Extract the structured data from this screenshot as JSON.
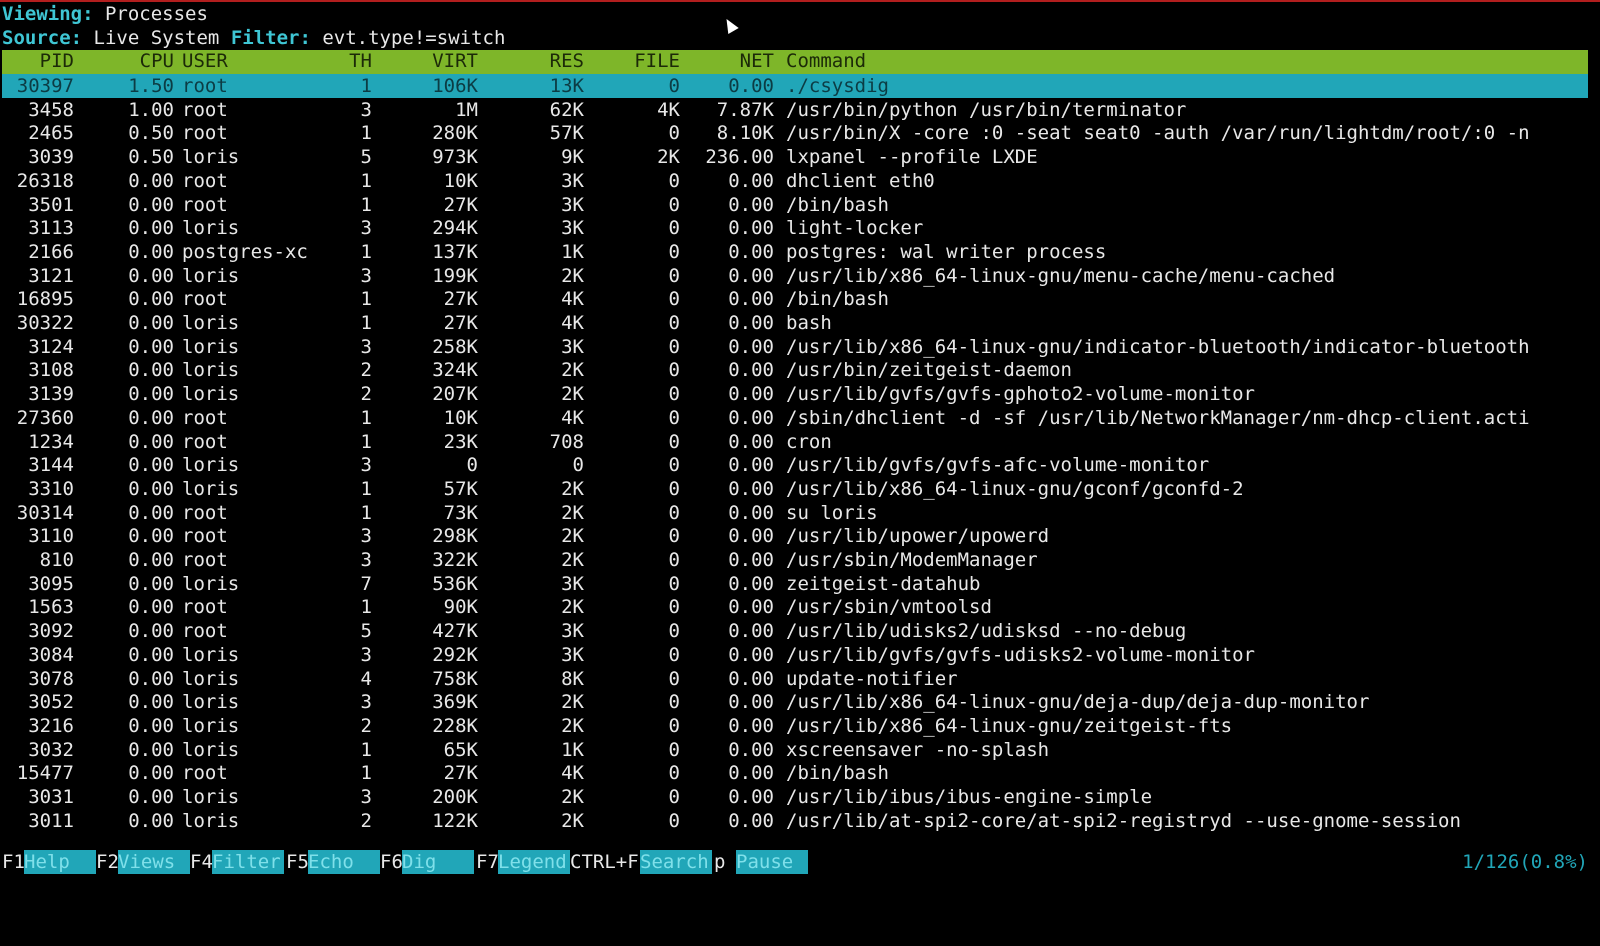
{
  "viewing": {
    "label": "Viewing:",
    "value": "Processes"
  },
  "source": {
    "label": "Source:",
    "value": "Live System",
    "filter_label": "Filter:",
    "filter_value": "evt.type!=switch"
  },
  "columns": {
    "pid": "PID",
    "cpu": "CPU",
    "user": "USER",
    "th": "TH",
    "virt": "VIRT",
    "res": "RES",
    "file": "FILE",
    "net": "NET",
    "cmd": "Command"
  },
  "colors": {
    "header_bg": "#7eb629",
    "selected_bg": "#21a6b8",
    "label": "#3fc6d4"
  },
  "rows": [
    {
      "pid": "30397",
      "cpu": "1.50",
      "user": "root",
      "th": "1",
      "virt": "106K",
      "res": "13K",
      "file": "0",
      "net": "0.00",
      "cmd": "./csysdig"
    },
    {
      "pid": "3458",
      "cpu": "1.00",
      "user": "root",
      "th": "3",
      "virt": "1M",
      "res": "62K",
      "file": "4K",
      "net": "7.87K",
      "cmd": "/usr/bin/python /usr/bin/terminator"
    },
    {
      "pid": "2465",
      "cpu": "0.50",
      "user": "root",
      "th": "1",
      "virt": "280K",
      "res": "57K",
      "file": "0",
      "net": "8.10K",
      "cmd": "/usr/bin/X -core :0 -seat seat0 -auth /var/run/lightdm/root/:0 -n"
    },
    {
      "pid": "3039",
      "cpu": "0.50",
      "user": "loris",
      "th": "5",
      "virt": "973K",
      "res": "9K",
      "file": "2K",
      "net": "236.00",
      "cmd": "lxpanel --profile LXDE"
    },
    {
      "pid": "26318",
      "cpu": "0.00",
      "user": "root",
      "th": "1",
      "virt": "10K",
      "res": "3K",
      "file": "0",
      "net": "0.00",
      "cmd": "dhclient eth0"
    },
    {
      "pid": "3501",
      "cpu": "0.00",
      "user": "root",
      "th": "1",
      "virt": "27K",
      "res": "3K",
      "file": "0",
      "net": "0.00",
      "cmd": "/bin/bash"
    },
    {
      "pid": "3113",
      "cpu": "0.00",
      "user": "loris",
      "th": "3",
      "virt": "294K",
      "res": "3K",
      "file": "0",
      "net": "0.00",
      "cmd": "light-locker"
    },
    {
      "pid": "2166",
      "cpu": "0.00",
      "user": "postgres-xc",
      "th": "1",
      "virt": "137K",
      "res": "1K",
      "file": "0",
      "net": "0.00",
      "cmd": "postgres: wal writer process"
    },
    {
      "pid": "3121",
      "cpu": "0.00",
      "user": "loris",
      "th": "3",
      "virt": "199K",
      "res": "2K",
      "file": "0",
      "net": "0.00",
      "cmd": "/usr/lib/x86_64-linux-gnu/menu-cache/menu-cached"
    },
    {
      "pid": "16895",
      "cpu": "0.00",
      "user": "root",
      "th": "1",
      "virt": "27K",
      "res": "4K",
      "file": "0",
      "net": "0.00",
      "cmd": "/bin/bash"
    },
    {
      "pid": "30322",
      "cpu": "0.00",
      "user": "loris",
      "th": "1",
      "virt": "27K",
      "res": "4K",
      "file": "0",
      "net": "0.00",
      "cmd": "bash"
    },
    {
      "pid": "3124",
      "cpu": "0.00",
      "user": "loris",
      "th": "3",
      "virt": "258K",
      "res": "3K",
      "file": "0",
      "net": "0.00",
      "cmd": "/usr/lib/x86_64-linux-gnu/indicator-bluetooth/indicator-bluetooth"
    },
    {
      "pid": "3108",
      "cpu": "0.00",
      "user": "loris",
      "th": "2",
      "virt": "324K",
      "res": "2K",
      "file": "0",
      "net": "0.00",
      "cmd": "/usr/bin/zeitgeist-daemon"
    },
    {
      "pid": "3139",
      "cpu": "0.00",
      "user": "loris",
      "th": "2",
      "virt": "207K",
      "res": "2K",
      "file": "0",
      "net": "0.00",
      "cmd": "/usr/lib/gvfs/gvfs-gphoto2-volume-monitor"
    },
    {
      "pid": "27360",
      "cpu": "0.00",
      "user": "root",
      "th": "1",
      "virt": "10K",
      "res": "4K",
      "file": "0",
      "net": "0.00",
      "cmd": "/sbin/dhclient -d -sf /usr/lib/NetworkManager/nm-dhcp-client.acti"
    },
    {
      "pid": "1234",
      "cpu": "0.00",
      "user": "root",
      "th": "1",
      "virt": "23K",
      "res": "708",
      "file": "0",
      "net": "0.00",
      "cmd": "cron"
    },
    {
      "pid": "3144",
      "cpu": "0.00",
      "user": "loris",
      "th": "3",
      "virt": "0",
      "res": "0",
      "file": "0",
      "net": "0.00",
      "cmd": "/usr/lib/gvfs/gvfs-afc-volume-monitor"
    },
    {
      "pid": "3310",
      "cpu": "0.00",
      "user": "loris",
      "th": "1",
      "virt": "57K",
      "res": "2K",
      "file": "0",
      "net": "0.00",
      "cmd": "/usr/lib/x86_64-linux-gnu/gconf/gconfd-2"
    },
    {
      "pid": "30314",
      "cpu": "0.00",
      "user": "root",
      "th": "1",
      "virt": "73K",
      "res": "2K",
      "file": "0",
      "net": "0.00",
      "cmd": "su loris"
    },
    {
      "pid": "3110",
      "cpu": "0.00",
      "user": "root",
      "th": "3",
      "virt": "298K",
      "res": "2K",
      "file": "0",
      "net": "0.00",
      "cmd": "/usr/lib/upower/upowerd"
    },
    {
      "pid": "810",
      "cpu": "0.00",
      "user": "root",
      "th": "3",
      "virt": "322K",
      "res": "2K",
      "file": "0",
      "net": "0.00",
      "cmd": "/usr/sbin/ModemManager"
    },
    {
      "pid": "3095",
      "cpu": "0.00",
      "user": "loris",
      "th": "7",
      "virt": "536K",
      "res": "3K",
      "file": "0",
      "net": "0.00",
      "cmd": "zeitgeist-datahub"
    },
    {
      "pid": "1563",
      "cpu": "0.00",
      "user": "root",
      "th": "1",
      "virt": "90K",
      "res": "2K",
      "file": "0",
      "net": "0.00",
      "cmd": "/usr/sbin/vmtoolsd"
    },
    {
      "pid": "3092",
      "cpu": "0.00",
      "user": "root",
      "th": "5",
      "virt": "427K",
      "res": "3K",
      "file": "0",
      "net": "0.00",
      "cmd": "/usr/lib/udisks2/udisksd --no-debug"
    },
    {
      "pid": "3084",
      "cpu": "0.00",
      "user": "loris",
      "th": "3",
      "virt": "292K",
      "res": "3K",
      "file": "0",
      "net": "0.00",
      "cmd": "/usr/lib/gvfs/gvfs-udisks2-volume-monitor"
    },
    {
      "pid": "3078",
      "cpu": "0.00",
      "user": "loris",
      "th": "4",
      "virt": "758K",
      "res": "8K",
      "file": "0",
      "net": "0.00",
      "cmd": "update-notifier"
    },
    {
      "pid": "3052",
      "cpu": "0.00",
      "user": "loris",
      "th": "3",
      "virt": "369K",
      "res": "2K",
      "file": "0",
      "net": "0.00",
      "cmd": "/usr/lib/x86_64-linux-gnu/deja-dup/deja-dup-monitor"
    },
    {
      "pid": "3216",
      "cpu": "0.00",
      "user": "loris",
      "th": "2",
      "virt": "228K",
      "res": "2K",
      "file": "0",
      "net": "0.00",
      "cmd": "/usr/lib/x86_64-linux-gnu/zeitgeist-fts"
    },
    {
      "pid": "3032",
      "cpu": "0.00",
      "user": "loris",
      "th": "1",
      "virt": "65K",
      "res": "1K",
      "file": "0",
      "net": "0.00",
      "cmd": "xscreensaver -no-splash"
    },
    {
      "pid": "15477",
      "cpu": "0.00",
      "user": "root",
      "th": "1",
      "virt": "27K",
      "res": "4K",
      "file": "0",
      "net": "0.00",
      "cmd": "/bin/bash"
    },
    {
      "pid": "3031",
      "cpu": "0.00",
      "user": "loris",
      "th": "3",
      "virt": "200K",
      "res": "2K",
      "file": "0",
      "net": "0.00",
      "cmd": "/usr/lib/ibus/ibus-engine-simple"
    },
    {
      "pid": "3011",
      "cpu": "0.00",
      "user": "loris",
      "th": "2",
      "virt": "122K",
      "res": "2K",
      "file": "0",
      "net": "0.00",
      "cmd": "/usr/lib/at-spi2-core/at-spi2-registryd --use-gnome-session"
    }
  ],
  "footer": {
    "keys": [
      {
        "key": "F1",
        "label": "Help"
      },
      {
        "key": "F2",
        "label": "Views"
      },
      {
        "key": "F4",
        "label": "Filter"
      },
      {
        "key": "F5",
        "label": "Echo"
      },
      {
        "key": "F6",
        "label": "Dig"
      },
      {
        "key": "F7",
        "label": "Legend"
      },
      {
        "key": "CTRL+F",
        "label": "Search"
      },
      {
        "key": "p",
        "label": "Pause"
      }
    ],
    "status": "1/126(0.8%)"
  }
}
